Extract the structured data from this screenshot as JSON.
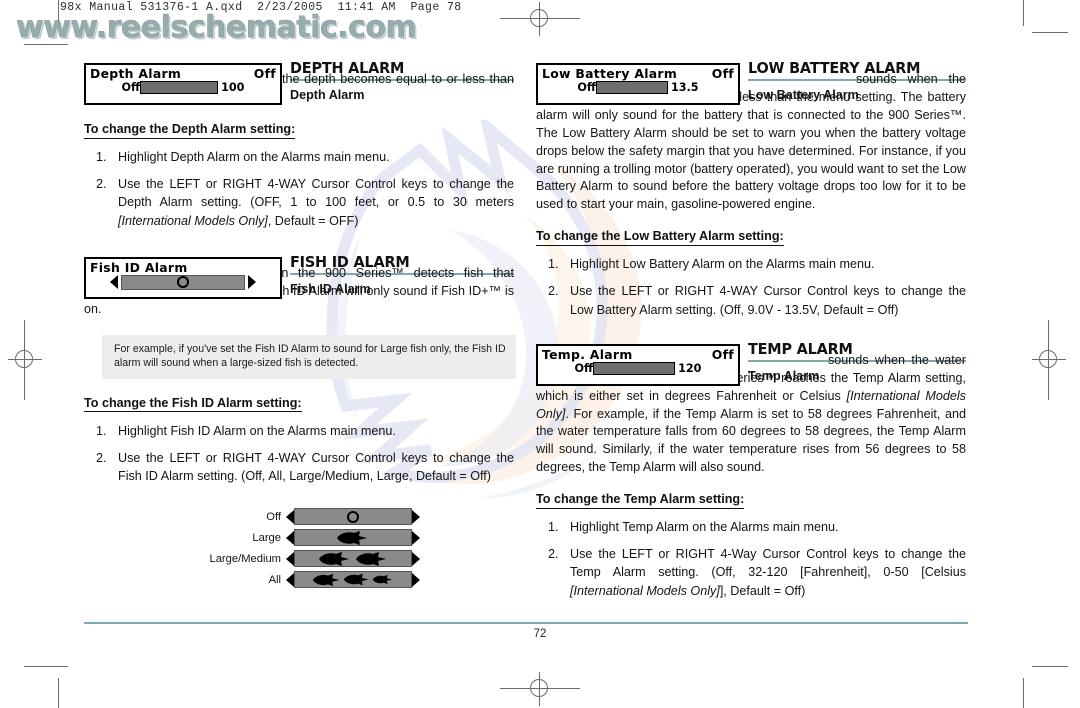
{
  "scan_header": "98x Manual 531376-1 A.qxd  2/23/2005  11:41 AM  Page 78",
  "watermark_url": "www.reelschematic.com",
  "footer": {
    "page_number": "72"
  },
  "colors": {
    "rule_teal": "#7fa8ae",
    "lcd_bar": "#6e6e6e",
    "note_bg": "#eceeed"
  },
  "left_column": {
    "depth": {
      "lcd": {
        "title": "Depth Alarm",
        "value": "Off",
        "min_label": "Off",
        "max_label": "100"
      },
      "heading": "DEPTH ALARM",
      "intro_bold": "Depth Alarm",
      "intro_rest": " sounds when the depth becomes equal to or less than the menu setting.",
      "subhead": "To change the Depth Alarm setting:",
      "steps": [
        {
          "num": "1.",
          "text": "Highlight Depth Alarm on the Alarms main menu."
        },
        {
          "num": "2.",
          "pre": "Use the LEFT or RIGHT 4-WAY Cursor Control keys to change the Depth Alarm setting. (OFF, 1 to 100 feet, or 0.5 to 30 meters ",
          "italic": "[International Models Only]",
          "post": ", Default = OFF)"
        }
      ]
    },
    "fish_id": {
      "lcd": {
        "title": "Fish ID Alarm",
        "slider_marker": "off-ring"
      },
      "heading": "FISH ID ALARM",
      "intro_bold": "Fish ID Alarm",
      "intro_rest": " sounds when the 900 Series™ detects fish that correspond to the alarm setting. Fish ID Alarm will only sound if Fish ID+™ is on.",
      "note": "For example, if you've set the Fish ID Alarm to sound for Large fish only, the Fish ID alarm will sound when a large-sized fish is detected.",
      "subhead": "To change the Fish ID Alarm setting:",
      "steps": [
        {
          "num": "1.",
          "text": "Highlight Fish ID Alarm on the Alarms main menu."
        },
        {
          "num": "2.",
          "pre": "Use the LEFT or RIGHT 4-WAY Cursor Control keys to change the Fish ID Alarm setting. (Off, All, Large/Medium, Large, Default = Off)",
          "italic": "",
          "post": ""
        }
      ],
      "options": [
        {
          "label": "Off",
          "fish_count": 0
        },
        {
          "label": "Large",
          "fish_count": 1
        },
        {
          "label": "Large/Medium",
          "fish_count": 2
        },
        {
          "label": "All",
          "fish_count": 3
        }
      ]
    }
  },
  "right_column": {
    "low_battery": {
      "lcd": {
        "title": "Low Battery Alarm",
        "value": "Off",
        "min_label": "Off",
        "max_label": "13.5"
      },
      "heading": "LOW BATTERY ALARM",
      "intro_bold": "Low Battery Alarm",
      "intro_rest": " sounds when the input battery voltage is equal to or less than the menu setting. The battery alarm will only sound for the battery that is connected to the 900 Series™. The Low Battery Alarm should be set to warn you when the battery voltage drops below the safety margin that you have determined. For instance, if you are running a trolling motor (battery operated), you would want to set the Low Battery Alarm to sound before the battery voltage drops too low for it to be used to start your main, gasoline-powered engine.",
      "subhead": "To change the Low Battery Alarm setting:",
      "steps": [
        {
          "num": "1.",
          "text": "Highlight Low Battery Alarm on the Alarms main menu."
        },
        {
          "num": "2.",
          "pre": "Use the LEFT or RIGHT 4-WAY Cursor Control keys to change the Low Battery Alarm setting. (Off, 9.0V - 13.5V, Default = Off)",
          "italic": "",
          "post": ""
        }
      ]
    },
    "temp": {
      "lcd": {
        "title": "Temp. Alarm",
        "value": "Off",
        "min_label": "Off",
        "max_label": "120"
      },
      "heading": "TEMP ALARM",
      "intro_bold": "Temp Alarm",
      "intro_a": " sounds when the water temperature detected by the 900 Series™ reaches the Temp Alarm setting, which is either set in degrees Fahrenheit or Celsius ",
      "intro_italic": "[International Models Only]",
      "intro_b": ". For example, if the Temp Alarm is set to 58 degrees Fahrenheit, and the water temperature falls from 60 degrees to 58 degrees, the Temp Alarm will sound. Similarly, if the water temperature rises from 56 degrees to 58 degrees, the Temp Alarm will also sound.",
      "subhead": "To change the Temp Alarm setting:",
      "steps": [
        {
          "num": "1.",
          "text": "Highlight Temp Alarm on the Alarms main menu."
        },
        {
          "num": "2.",
          "pre": "Use the LEFT or RIGHT 4-Way Cursor Control keys to change the Temp Alarm setting. (Off, 32-120 [Fahrenheit], 0-50 [Celsius ",
          "italic": "[International Models Only]",
          "post": "], Default = Off)"
        }
      ]
    }
  }
}
